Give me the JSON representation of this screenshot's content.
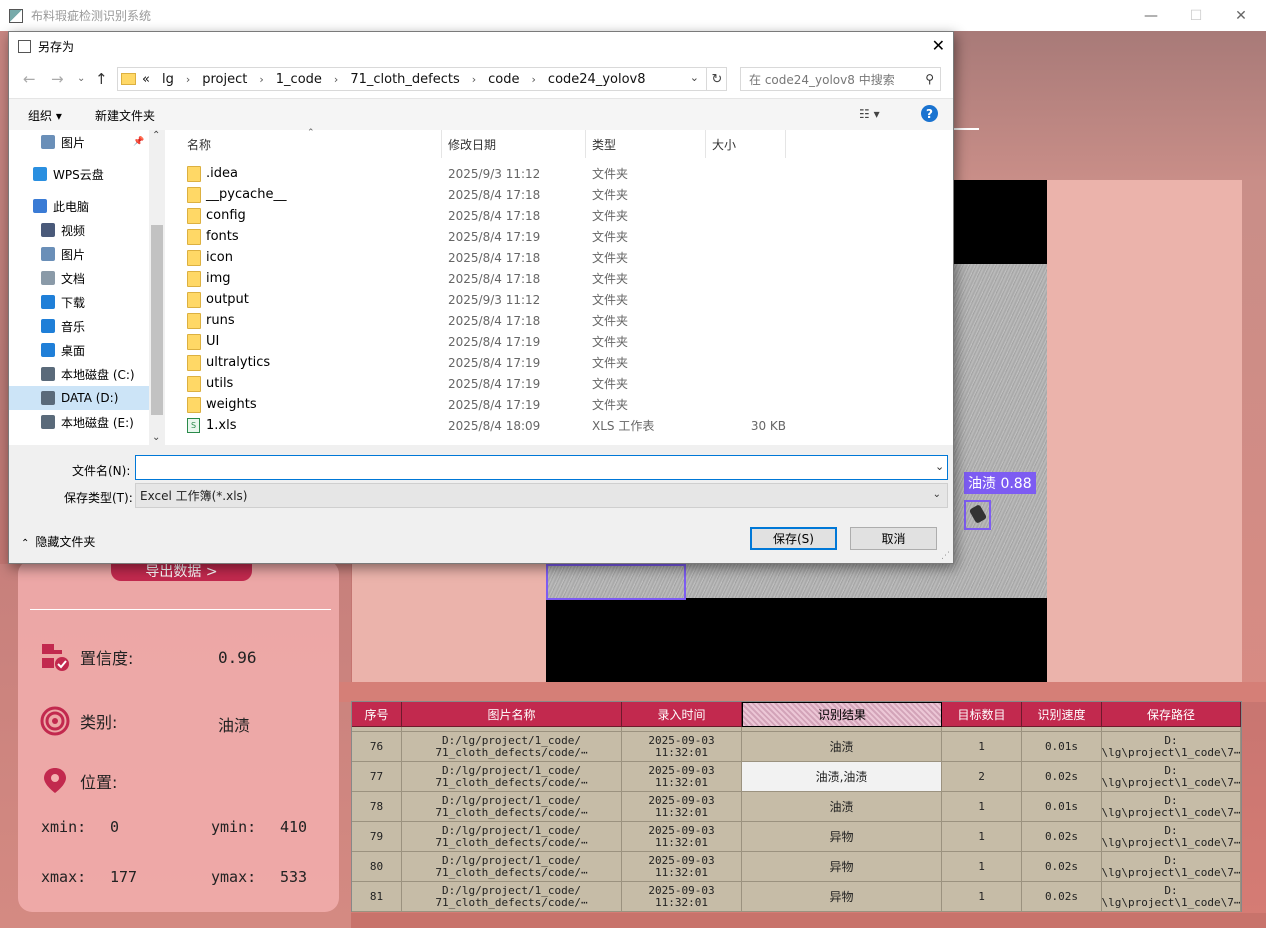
{
  "app": {
    "title": "布料瑕疵检测识别系统",
    "minimize": "—",
    "maximize": "☐",
    "close": "✕"
  },
  "left_panel": {
    "export_label": "导出数据 >",
    "confidence_label": "置信度:",
    "confidence_value": "0.96",
    "class_label": "类别:",
    "class_value": "油渍",
    "position_label": "位置:",
    "xmin_label": "xmin:",
    "xmin_value": "0",
    "ymin_label": "ymin:",
    "ymin_value": "410",
    "xmax_label": "xmax:",
    "xmax_value": "177",
    "ymax_label": "ymax:",
    "ymax_value": "533"
  },
  "detection": {
    "label": "油渍 0.88",
    "box_color": "#7d5cf2"
  },
  "table": {
    "headers": [
      "序号",
      "图片名称",
      "录入时间",
      "识别结果",
      "目标数目",
      "识别速度",
      "保存路径"
    ],
    "rows": [
      {
        "id": "76",
        "name": "D:/lg/project/1_code/\n71_cloth_defects/code/⋯",
        "time": "2025-09-03\n11:32:01",
        "result": "油渍",
        "count": "1",
        "speed": "0.01s",
        "path": "D:\n\\lg\\project\\1_code\\7⋯"
      },
      {
        "id": "77",
        "name": "D:/lg/project/1_code/\n71_cloth_defects/code/⋯",
        "time": "2025-09-03\n11:32:01",
        "result": "油渍,油渍",
        "count": "2",
        "speed": "0.02s",
        "path": "D:\n\\lg\\project\\1_code\\7⋯"
      },
      {
        "id": "78",
        "name": "D:/lg/project/1_code/\n71_cloth_defects/code/⋯",
        "time": "2025-09-03\n11:32:01",
        "result": "油渍",
        "count": "1",
        "speed": "0.01s",
        "path": "D:\n\\lg\\project\\1_code\\7⋯"
      },
      {
        "id": "79",
        "name": "D:/lg/project/1_code/\n71_cloth_defects/code/⋯",
        "time": "2025-09-03\n11:32:01",
        "result": "异物",
        "count": "1",
        "speed": "0.02s",
        "path": "D:\n\\lg\\project\\1_code\\7⋯"
      },
      {
        "id": "80",
        "name": "D:/lg/project/1_code/\n71_cloth_defects/code/⋯",
        "time": "2025-09-03\n11:32:01",
        "result": "异物",
        "count": "1",
        "speed": "0.02s",
        "path": "D:\n\\lg\\project\\1_code\\7⋯"
      },
      {
        "id": "81",
        "name": "D:/lg/project/1_code/\n71_cloth_defects/code/⋯",
        "time": "2025-09-03\n11:32:01",
        "result": "异物",
        "count": "1",
        "speed": "0.02s",
        "path": "D:\n\\lg\\project\\1_code\\7⋯"
      }
    ]
  },
  "dialog": {
    "title": "另存为",
    "close": "✕",
    "breadcrumbs": [
      "«",
      "lg",
      "project",
      "1_code",
      "71_cloth_defects",
      "code",
      "code24_yolov8"
    ],
    "search_placeholder": "在 code24_yolov8 中搜索",
    "organize": "组织 ▾",
    "new_folder": "新建文件夹",
    "view_toggle": "☷ ▾",
    "help": "?",
    "nav_items": [
      {
        "label": "图片",
        "icon": "pictures-icon",
        "color": "#6a8fb8"
      },
      {
        "label": "WPS云盘",
        "icon": "cloud-icon",
        "color": "#2a8fe0"
      },
      {
        "label": "此电脑",
        "icon": "computer-icon",
        "color": "#3a7bd5"
      },
      {
        "label": "视频",
        "icon": "video-icon",
        "color": "#4a5a7a"
      },
      {
        "label": "图片",
        "icon": "pictures-icon",
        "color": "#6a8fb8"
      },
      {
        "label": "文档",
        "icon": "documents-icon",
        "color": "#8a9aa8"
      },
      {
        "label": "下载",
        "icon": "download-icon",
        "color": "#1f7fd8"
      },
      {
        "label": "音乐",
        "icon": "music-icon",
        "color": "#1f7fd8"
      },
      {
        "label": "桌面",
        "icon": "desktop-icon",
        "color": "#1f7fd8"
      },
      {
        "label": "本地磁盘 (C:)",
        "icon": "drive-c-icon",
        "color": "#5a6a7a"
      },
      {
        "label": "DATA (D:)",
        "icon": "drive-d-icon",
        "color": "#5a6a7a"
      },
      {
        "label": "本地磁盘 (E:)",
        "icon": "drive-e-icon",
        "color": "#5a6a7a"
      }
    ],
    "columns": [
      "名称",
      "修改日期",
      "类型",
      "大小"
    ],
    "files": [
      {
        "name": ".idea",
        "date": "2025/9/3 11:12",
        "type": "文件夹",
        "size": ""
      },
      {
        "name": "__pycache__",
        "date": "2025/8/4 17:18",
        "type": "文件夹",
        "size": ""
      },
      {
        "name": "config",
        "date": "2025/8/4 17:18",
        "type": "文件夹",
        "size": ""
      },
      {
        "name": "fonts",
        "date": "2025/8/4 17:19",
        "type": "文件夹",
        "size": ""
      },
      {
        "name": "icon",
        "date": "2025/8/4 17:18",
        "type": "文件夹",
        "size": ""
      },
      {
        "name": "img",
        "date": "2025/8/4 17:18",
        "type": "文件夹",
        "size": ""
      },
      {
        "name": "output",
        "date": "2025/9/3 11:12",
        "type": "文件夹",
        "size": ""
      },
      {
        "name": "runs",
        "date": "2025/8/4 17:18",
        "type": "文件夹",
        "size": ""
      },
      {
        "name": "UI",
        "date": "2025/8/4 17:19",
        "type": "文件夹",
        "size": ""
      },
      {
        "name": "ultralytics",
        "date": "2025/8/4 17:19",
        "type": "文件夹",
        "size": ""
      },
      {
        "name": "utils",
        "date": "2025/8/4 17:19",
        "type": "文件夹",
        "size": ""
      },
      {
        "name": "weights",
        "date": "2025/8/4 17:19",
        "type": "文件夹",
        "size": ""
      },
      {
        "name": "1.xls",
        "date": "2025/8/4 18:09",
        "type": "XLS 工作表",
        "size": "30 KB"
      }
    ],
    "filename_label": "文件名(N):",
    "filename_value": "",
    "filetype_label": "保存类型(T):",
    "filetype_value": "Excel 工作簿(*.xls)",
    "hide_folders": "隐藏文件夹",
    "save": "保存(S)",
    "cancel": "取消"
  }
}
